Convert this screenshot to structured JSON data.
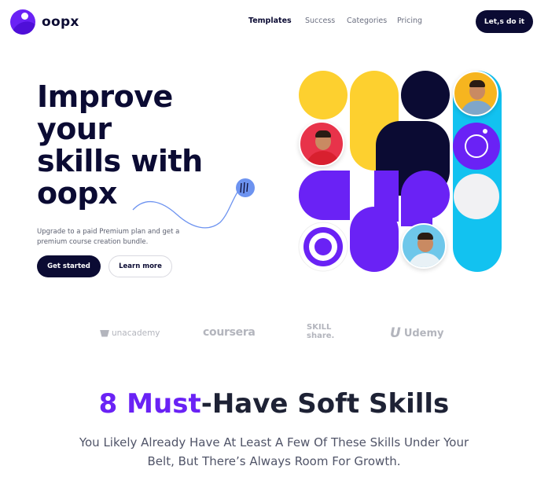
{
  "brand": {
    "name": "oopx"
  },
  "nav": {
    "items": [
      {
        "label": "Templates",
        "active": true
      },
      {
        "label": "Success",
        "active": false
      },
      {
        "label": "Categories",
        "active": false
      },
      {
        "label": "Pricing",
        "active": false
      }
    ],
    "cta_label": "Let,s do it"
  },
  "hero": {
    "title_lines": [
      "Improve",
      "your",
      "skills with",
      "oopx"
    ],
    "subtitle": "Upgrade to a paid Premium plan and get a premium course creation bundle.",
    "primary_button": "Get started",
    "secondary_button": "Learn more"
  },
  "partners": {
    "unacademy": "unacademy",
    "coursera": "coursera",
    "skillshare_line1": "SKILL",
    "skillshare_line2": "share.",
    "udemy": "Udemy"
  },
  "section": {
    "title_accent": "8 Must",
    "title_rest": "-Have Soft Skills",
    "subtitle": "You Likely Already Have At Least A Few Of These Skills Under Your Belt, But There’s Always Room For Growth."
  },
  "colors": {
    "navy": "#0b0b33",
    "purple": "#6a22f5",
    "yellow": "#fdd02f",
    "cyan": "#12c2f0",
    "grey_logo": "#b3b5bd"
  }
}
